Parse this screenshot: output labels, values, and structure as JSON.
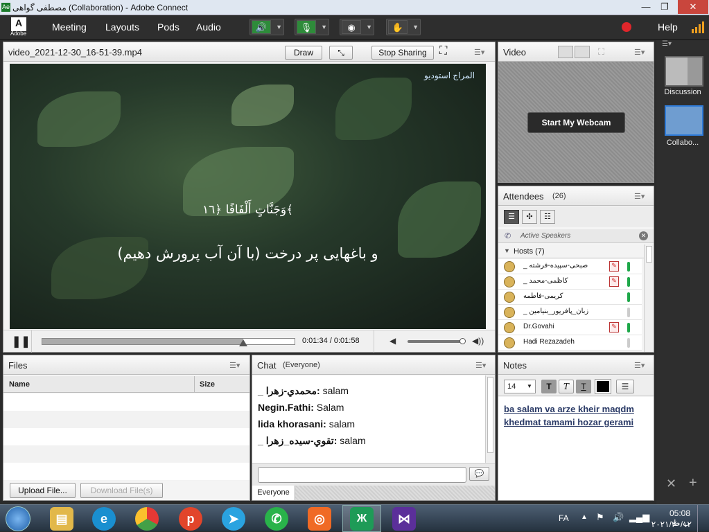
{
  "window": {
    "title": "مصطفی گواهی (Collaboration) - Adobe Connect",
    "minimize": "—",
    "restore": "❐",
    "close": "✕"
  },
  "menu": {
    "logo": "Adobe",
    "items": [
      "Meeting",
      "Layouts",
      "Pods",
      "Audio"
    ],
    "help": "Help"
  },
  "share_pod": {
    "title": "video_2021-12-30_16-51-39.mp4",
    "draw_label": "Draw",
    "stop_sharing_label": "Stop Sharing",
    "watermark": "المراج استودیو",
    "arabic_line": "وَجَنَّاتٍ أَلْفَافًا ﴿١٦﴾",
    "persian_line": "و باغهایی پر درخت (با آن آب پرورش دهیم)",
    "time_display": "0:01:34 / 0:01:58",
    "progress_percent": 79.6,
    "volume_percent": 100
  },
  "video_pod": {
    "title": "Video",
    "webcam_button": "Start My Webcam"
  },
  "attendees_pod": {
    "title": "Attendees",
    "count": "(26)",
    "active_speakers": "Active Speakers",
    "hosts_label": "Hosts (7)",
    "hosts": [
      {
        "name": "_ صبحی-سپیده-فرشته",
        "mic": true,
        "level": "on"
      },
      {
        "name": "_ کاظمی-محمد",
        "mic": true,
        "level": "on"
      },
      {
        "name": "کریمی-فاطمه",
        "mic": false,
        "level": "on"
      },
      {
        "name": "_ زبان_پافریور_بنیامین",
        "mic": false,
        "level": "off"
      },
      {
        "name": "Dr.Govahi",
        "mic": true,
        "level": "on"
      },
      {
        "name": "Hadi Rezazadeh",
        "mic": false,
        "level": "off"
      }
    ]
  },
  "files_pod": {
    "title": "Files",
    "col_name": "Name",
    "col_size": "Size",
    "upload_label": "Upload File...",
    "download_label": "Download File(s)"
  },
  "chat_pod": {
    "title": "Chat",
    "audience": "(Everyone)",
    "messages": [
      {
        "sender": "_ محمدي-زهرا:",
        "text": "salam"
      },
      {
        "sender": "Negin.Fathi:",
        "text": "Salam"
      },
      {
        "sender": "lida khorasani:",
        "text": "salam"
      },
      {
        "sender": "_ تقوي-سيده_زهرا:",
        "text": "salam"
      }
    ],
    "tab_label": "Everyone"
  },
  "notes_pod": {
    "title": "Notes",
    "font_size": "14",
    "text_line1": "ba salam va arze kheir maqdm",
    "text_line2": "khedmat tamami hozar gerami"
  },
  "layouts": [
    {
      "label": "Discussion"
    },
    {
      "label": "Collabo..."
    }
  ],
  "taskbar": {
    "lang": "FA",
    "time": "05:08 ب.ظ",
    "date": "۲۰۲۱/۳۰/۱۲"
  },
  "colors": {
    "accent": "#1fa84a",
    "record": "#e0262b"
  }
}
